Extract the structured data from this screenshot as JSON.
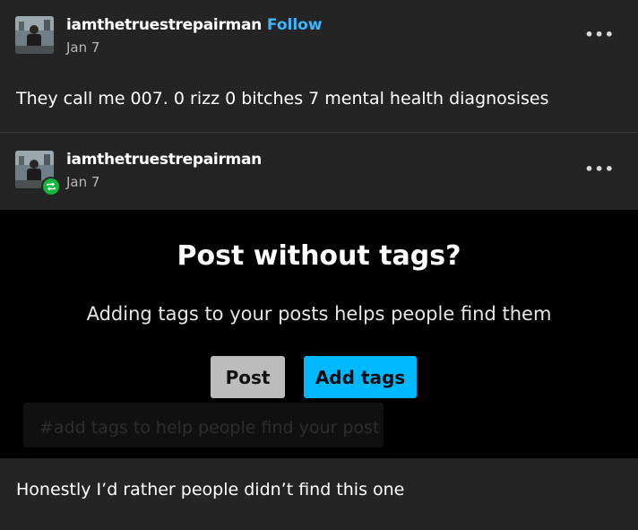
{
  "post1": {
    "username": "iamthetruestrepairman",
    "follow_label": "Follow",
    "date": "Jan 7",
    "more_icon": "more-dots-icon",
    "text": "They call me 007. 0 rizz 0 bitches 7 mental health diagnosises"
  },
  "post2": {
    "username": "iamthetruestrepairman",
    "date": "Jan 7",
    "more_icon": "more-dots-icon",
    "reblog_icon": "reblog-icon",
    "reblog_color": "#11b83e",
    "screenshot": {
      "title": "Post without tags?",
      "message": "Adding tags to your posts helps people find them",
      "post_button": "Post",
      "add_tags_button": "Add tags",
      "tags_placeholder": "#add tags to help people find your post",
      "accent": "#00b8ff"
    },
    "caption": "Honestly I’d rather people didn’t find this one"
  },
  "colors": {
    "background": "#242424",
    "follow": "#3eb6ff"
  }
}
